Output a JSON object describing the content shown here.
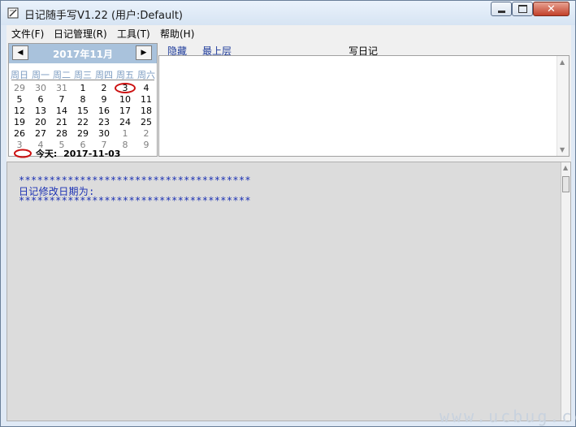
{
  "window": {
    "title": "日记随手写V1.22 (用户:Default)",
    "icon": "notebook-icon",
    "controls": [
      "minimize-icon",
      "maximize-icon",
      "close-icon"
    ]
  },
  "menu": [
    "文件(F)",
    "日记管理(R)",
    "工具(T)",
    "帮助(H)"
  ],
  "calendar": {
    "title": "2017年11月",
    "prev": "◀",
    "next": "▶",
    "weekdays": [
      "周日",
      "周一",
      "周二",
      "周三",
      "周四",
      "周五",
      "周六"
    ],
    "weeks": [
      [
        "29",
        "30",
        "31",
        "1",
        "2",
        "3",
        "4"
      ],
      [
        "5",
        "6",
        "7",
        "8",
        "9",
        "10",
        "11"
      ],
      [
        "12",
        "13",
        "14",
        "15",
        "16",
        "17",
        "18"
      ],
      [
        "19",
        "20",
        "21",
        "22",
        "23",
        "24",
        "25"
      ],
      [
        "26",
        "27",
        "28",
        "29",
        "30",
        "1",
        "2"
      ],
      [
        "3",
        "4",
        "5",
        "6",
        "7",
        "8",
        "9"
      ]
    ],
    "selected_day": "3",
    "today_label": "今天:",
    "today_value": "2017-11-03",
    "highlight_color": "#cc1111"
  },
  "toolbar": {
    "hide": "隐藏",
    "top_level": "最上层",
    "write_diary": "写日记"
  },
  "editor": {
    "lines": [
      "**************************************",
      "日记修改日期为:",
      "**************************************"
    ],
    "text_color": "#1b31b4"
  },
  "watermark": "www.ucbug.cc"
}
